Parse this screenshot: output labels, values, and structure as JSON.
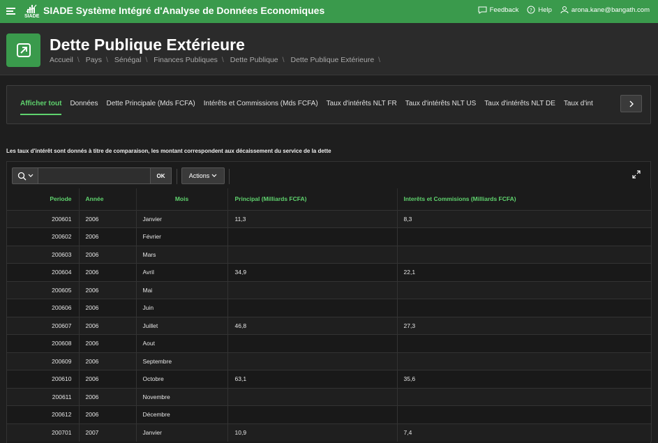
{
  "app": {
    "title": "SIADE Système Intégré d'Analyse de Données Economiques",
    "logo_text": "SIADE",
    "feedback_label": "Feedback",
    "help_label": "Help",
    "user_email": "arona.kane@bangath.com",
    "accent_color": "#3a9a4c"
  },
  "page": {
    "title": "Dette Publique Extérieure",
    "breadcrumb": [
      "Accueil",
      "Pays",
      "Sénégal",
      "Finances Publiques",
      "Dette Publique",
      "Dette Publique Extérieure"
    ]
  },
  "tabs": [
    {
      "label": "Afficher tout",
      "active": true
    },
    {
      "label": "Données"
    },
    {
      "label": "Dette Principale (Mds FCFA)"
    },
    {
      "label": "Intérêts et Commissions (Mds FCFA)"
    },
    {
      "label": "Taux d'intérêts NLT FR"
    },
    {
      "label": "Taux d'intérêts NLT US"
    },
    {
      "label": "Taux d'intérêts NLT DE"
    },
    {
      "label": "Taux d'int"
    }
  ],
  "note": "Les taux d'intérêt sont donnés à titre de comparaison, les montant correspondent aux décaissement du service de la dette",
  "toolbar": {
    "search_value": "",
    "go_label": "OK",
    "actions_label": "Actions"
  },
  "table": {
    "headers": {
      "periode": "Periode",
      "annee": "Année",
      "mois": "Mois",
      "principal": "Principal (Milliards FCFA)",
      "interets": "Interêts et Commisions (Milliards FCFA)"
    },
    "rows": [
      {
        "periode": "200601",
        "annee": "2006",
        "mois": "Janvier",
        "principal": "11,3",
        "interets": "8,3"
      },
      {
        "periode": "200602",
        "annee": "2006",
        "mois": "Février",
        "principal": "",
        "interets": ""
      },
      {
        "periode": "200603",
        "annee": "2006",
        "mois": "Mars",
        "principal": "",
        "interets": ""
      },
      {
        "periode": "200604",
        "annee": "2006",
        "mois": "Avril",
        "principal": "34,9",
        "interets": "22,1"
      },
      {
        "periode": "200605",
        "annee": "2006",
        "mois": "Mai",
        "principal": "",
        "interets": ""
      },
      {
        "periode": "200606",
        "annee": "2006",
        "mois": "Juin",
        "principal": "",
        "interets": ""
      },
      {
        "periode": "200607",
        "annee": "2006",
        "mois": "Juillet",
        "principal": "46,8",
        "interets": "27,3"
      },
      {
        "periode": "200608",
        "annee": "2006",
        "mois": "Aout",
        "principal": "",
        "interets": ""
      },
      {
        "periode": "200609",
        "annee": "2006",
        "mois": "Septembre",
        "principal": "",
        "interets": ""
      },
      {
        "periode": "200610",
        "annee": "2006",
        "mois": "Octobre",
        "principal": "63,1",
        "interets": "35,6"
      },
      {
        "periode": "200611",
        "annee": "2006",
        "mois": "Novembre",
        "principal": "",
        "interets": ""
      },
      {
        "periode": "200612",
        "annee": "2006",
        "mois": "Décembre",
        "principal": "",
        "interets": ""
      },
      {
        "periode": "200701",
        "annee": "2007",
        "mois": "Janvier",
        "principal": "10,9",
        "interets": "7,4"
      }
    ]
  }
}
